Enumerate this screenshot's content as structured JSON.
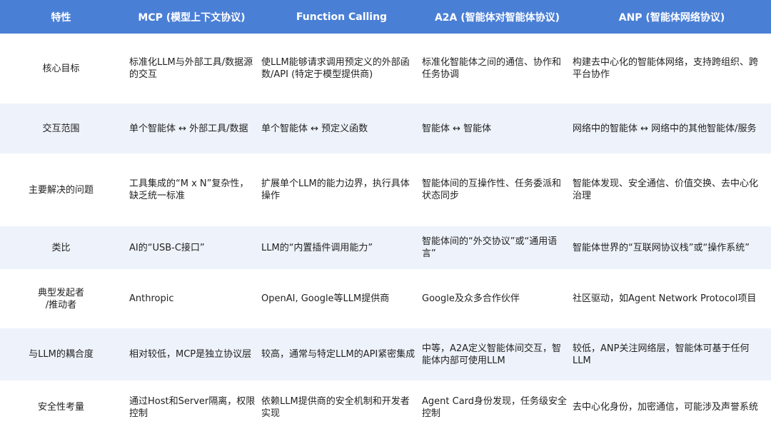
{
  "table": {
    "headers": [
      "特性",
      "MCP (模型上下文协议)",
      "Function Calling",
      "A2A (智能体对智能体协议)",
      "ANP (智能体网络协议)"
    ],
    "rows": [
      {
        "feature": "核心目标",
        "cells": [
          "标准化LLM与外部工具/数据源的交互",
          "使LLM能够请求调用预定义的外部函数/API (特定于模型提供商)",
          "标准化智能体之间的通信、协作和任务协调",
          "构建去中心化的智能体网络，支持跨组织、跨平台协作"
        ]
      },
      {
        "feature": "交互范围",
        "cells": [
          "单个智能体 ↔ 外部工具/数据",
          "单个智能体 ↔ 预定义函数",
          "智能体 ↔ 智能体",
          "网络中的智能体 ↔ 网络中的其他智能体/服务"
        ]
      },
      {
        "feature": "主要解决的问题",
        "cells": [
          "工具集成的“M x N”复杂性，缺乏统一标准",
          "扩展单个LLM的能力边界，执行具体操作",
          "智能体间的互操作性、任务委派和状态同步",
          "智能体发现、安全通信、价值交换、去中心化治理"
        ]
      },
      {
        "feature": "类比",
        "cells": [
          "AI的“USB-C接口”",
          "LLM的“内置插件调用能力”",
          "智能体间的“外交协议”或“通用语言”",
          "智能体世界的“互联网协议栈”或“操作系统”"
        ]
      },
      {
        "feature": "典型发起者\n/推动者",
        "cells": [
          "Anthropic",
          "OpenAI, Google等LLM提供商",
          "Google及众多合作伙伴",
          "社区驱动，如Agent Network Protocol项目"
        ]
      },
      {
        "feature": "与LLM的耦合度",
        "cells": [
          "相对较低，MCP是独立协议层",
          "较高，通常与特定LLM的API紧密集成",
          "中等，A2A定义智能体间交互，智能体内部可使用LLM",
          "较低，ANP关注网络层，智能体可基于任何LLM"
        ]
      },
      {
        "feature": "安全性考量",
        "cells": [
          "通过Host和Server隔离，权限控制",
          "依赖LLM提供商的安全机制和开发者实现",
          "Agent Card身份发现，任务级安全控制",
          "去中心化身份，加密通信，可能涉及声誉系统"
        ]
      }
    ]
  }
}
